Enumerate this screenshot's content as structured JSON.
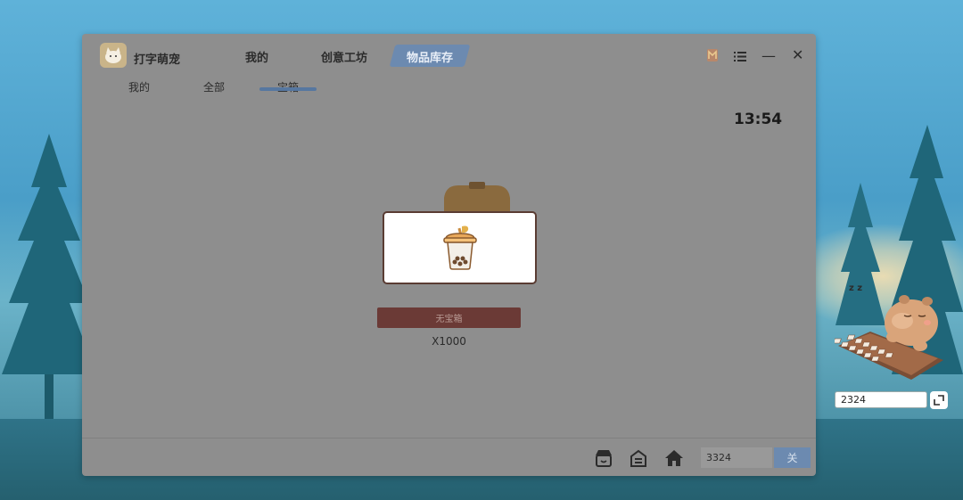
{
  "app": {
    "name": "打字萌宠"
  },
  "nav": {
    "items": [
      {
        "label": "我的"
      },
      {
        "label": "创意工坊"
      },
      {
        "label": "物品库存"
      }
    ],
    "active_index": 2
  },
  "window_controls": {
    "icons": [
      "coin-icon",
      "list-icon",
      "minimize-icon",
      "close-icon"
    ],
    "minimize_glyph": "—",
    "close_glyph": "✕"
  },
  "subtabs": {
    "items": [
      {
        "label": "我的"
      },
      {
        "label": "全部"
      },
      {
        "label": "宝箱"
      }
    ],
    "active_index": 2
  },
  "clock": "13:54",
  "content": {
    "no_chest_label": "无宝箱",
    "count_label": "X1000"
  },
  "bottom_bar": {
    "icons": [
      "shop-icon",
      "storage-icon",
      "home-icon"
    ],
    "input_value": "3324",
    "button_label": "关"
  },
  "pet_widget": {
    "input_value": "2324",
    "sleep_text": "z z"
  },
  "colors": {
    "accent": "#6c8ab0",
    "overlay_gray": "#8e8e8e",
    "button_dark": "#6b3a36"
  }
}
